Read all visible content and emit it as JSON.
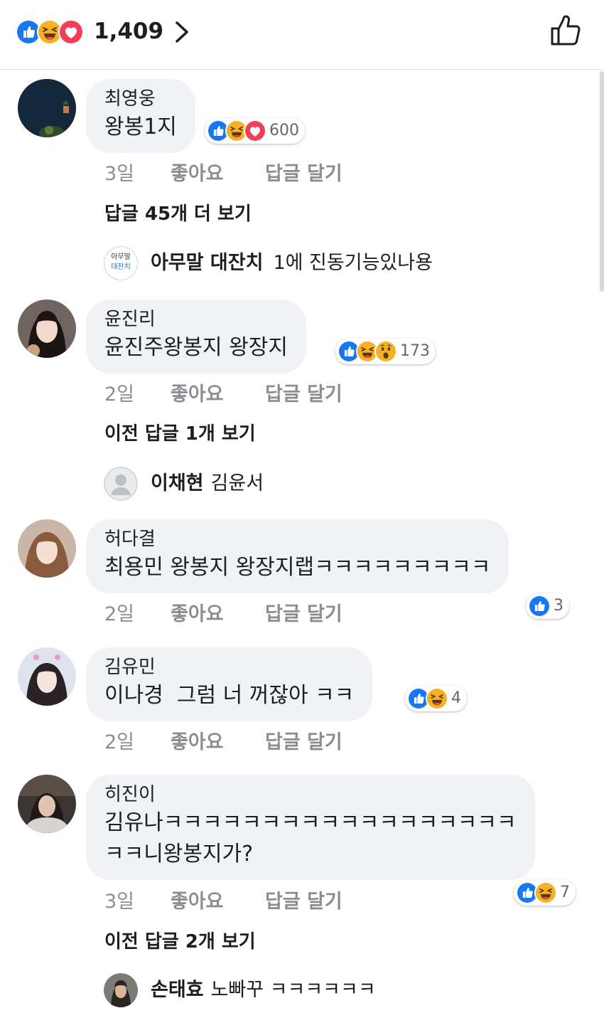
{
  "header": {
    "reaction_count": "1,409",
    "reactions": [
      "like-icon",
      "haha-icon",
      "love-icon"
    ]
  },
  "colors": {
    "like": "#1877f2",
    "love": "#f33e58",
    "haha": "#f7b125",
    "text": "#1c1e21",
    "meta": "#8a8d91",
    "bubble": "#f0f2f5"
  },
  "comments": [
    {
      "author": "최영웅",
      "text": "왕봉1지",
      "reactions": [
        "like-icon",
        "haha-icon",
        "love-icon"
      ],
      "reaction_count": "600",
      "time": "3일",
      "like_label": "좋아요",
      "reply_label": "답글 달기",
      "more_replies": "답글 45개 더 보기",
      "reply": {
        "avatar_line1": "아무말",
        "avatar_line2": "대잔치",
        "name": "아무말 대잔치",
        "text": "1에 진동기능있나용"
      }
    },
    {
      "author": "윤진리",
      "text": "윤진주왕봉지 왕장지",
      "reactions": [
        "like-icon",
        "haha-icon",
        "wow-icon"
      ],
      "reaction_count": "173",
      "time": "2일",
      "like_label": "좋아요",
      "reply_label": "답글 달기",
      "more_replies": "이전 답글 1개 보기",
      "reply": {
        "name": "이채현",
        "text": "김윤서"
      }
    },
    {
      "author": "허다결",
      "text": "최용민 왕봉지 왕장지랩ㅋㅋㅋㅋㅋㅋㅋㅋㅋ",
      "reactions": [
        "like-icon"
      ],
      "reaction_count": "3",
      "time": "2일",
      "like_label": "좋아요",
      "reply_label": "답글 달기"
    },
    {
      "author": "김유민",
      "text": "이나경  그럼 너 꺼잖아 ㅋㅋ",
      "reactions": [
        "like-icon",
        "haha-icon"
      ],
      "reaction_count": "4",
      "time": "2일",
      "like_label": "좋아요",
      "reply_label": "답글 달기"
    },
    {
      "author": "히진이",
      "text_line1": "김유나ㅋㅋㅋㅋㅋㅋㅋㅋㅋㅋㅋㅋㅋㅋㅋㅋㅋㅋ",
      "text_line2": "ㅋㅋ니왕봉지가?",
      "reactions": [
        "like-icon",
        "haha-icon"
      ],
      "reaction_count": "7",
      "time": "3일",
      "like_label": "좋아요",
      "reply_label": "답글 달기",
      "more_replies": "이전 답글 2개 보기",
      "reply": {
        "name": "손태효",
        "text": "노빠꾸 ㅋㅋㅋㅋㅋㅋ"
      }
    }
  ]
}
